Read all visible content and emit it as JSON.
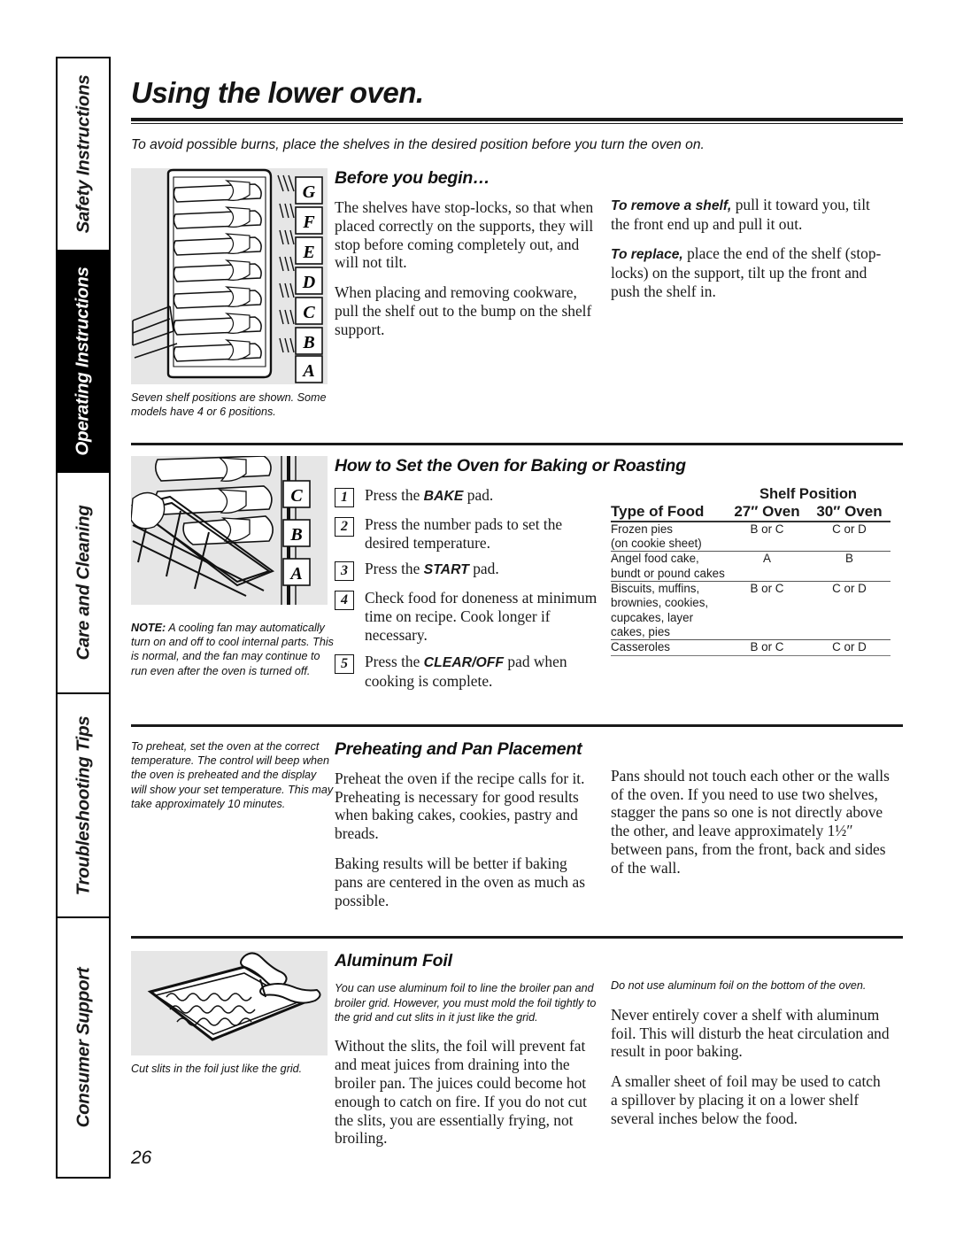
{
  "sidebar": {
    "tabs": [
      {
        "label": "Safety Instructions",
        "active": false
      },
      {
        "label": "Operating Instructions",
        "active": true
      },
      {
        "label": "Care and Cleaning",
        "active": false
      },
      {
        "label": "Troubleshooting Tips",
        "active": false
      },
      {
        "label": "Consumer Support",
        "active": false
      }
    ]
  },
  "header": {
    "title": "Using the lower oven.",
    "lede": "To avoid possible burns, place the shelves in the desired position before you turn the oven on."
  },
  "before_you_begin": {
    "heading": "Before you begin…",
    "left_p1": "The shelves have stop-locks, so that when placed correctly on the supports, they will stop before coming completely out, and will not tilt.",
    "left_p2": "When placing and removing cookware, pull the shelf out to the bump on the shelf support.",
    "right_p1_lead": "To remove a shelf,",
    "right_p1": " pull it toward you, tilt the front end up and pull it out.",
    "right_p2_lead": "To replace,",
    "right_p2": " place the end of the shelf (stop-locks) on the support, tilt up the front and push the shelf in.",
    "art_letters": [
      "G",
      "F",
      "E",
      "D",
      "C",
      "B",
      "A"
    ],
    "caption": "Seven shelf positions are shown. Some models have 4 or 6 positions."
  },
  "baking": {
    "heading": "How to Set the Oven for Baking or Roasting",
    "steps": [
      {
        "num": "1",
        "pre": "Press the ",
        "kbd": "BAKE",
        "post": " pad."
      },
      {
        "num": "2",
        "pre": "Press the number pads to set the desired temperature.",
        "kbd": "",
        "post": ""
      },
      {
        "num": "3",
        "pre": "Press the ",
        "kbd": "START",
        "post": " pad."
      },
      {
        "num": "4",
        "pre": "Check food for doneness at minimum time on recipe. Cook longer if necessary.",
        "kbd": "",
        "post": ""
      },
      {
        "num": "5",
        "pre": "Press the ",
        "kbd": "CLEAR/OFF",
        "post": " pad when cooking is complete."
      }
    ],
    "art_letters": [
      "C",
      "B",
      "A"
    ],
    "note_lead": "NOTE:",
    "note": " A cooling fan may automatically turn on and off to cool internal parts. This is normal, and the fan may continue to run even after the oven is turned off.",
    "table": {
      "spanner": "Shelf Position",
      "columns": [
        "Type of Food",
        "27″ Oven",
        "30″ Oven"
      ],
      "rows": [
        {
          "food": "Frozen pies\n(on cookie sheet)",
          "oven27": "B or C",
          "oven30": "C or D"
        },
        {
          "food": "Angel food cake,\nbundt or pound cakes",
          "oven27": "A",
          "oven30": "B"
        },
        {
          "food": "Biscuits, muffins,\nbrownies, cookies,\ncupcakes, layer\ncakes, pies",
          "oven27": "B or C",
          "oven30": "C or D"
        },
        {
          "food": "Casseroles",
          "oven27": "B or C",
          "oven30": "C or D"
        }
      ]
    }
  },
  "preheating": {
    "heading": "Preheating and Pan Placement",
    "side_note": "To preheat, set the oven at the correct temperature. The control will beep when the oven is preheated and the display will show your set temperature. This may take approximately 10 minutes.",
    "left_p1": "Preheat the oven if the recipe calls for it. Preheating is necessary for good results when baking cakes, cookies, pastry and breads.",
    "left_p2": "Baking results will be better if baking pans are centered in the oven as much as possible.",
    "right_p1": "Pans should not touch each other or the walls of the oven. If you need to use two shelves, stagger the pans so one is not directly above the other, and leave approximately 1½″ between pans, from the front, back and sides of the wall."
  },
  "aluminum_foil": {
    "heading": "Aluminum Foil",
    "left_italic": "You can use aluminum foil to line the broiler pan and broiler grid. However, you must mold the foil tightly to the grid and cut slits in it just like the grid.",
    "left_p1": "Without the slits, the foil will prevent fat and meat juices from draining into the broiler pan. The juices could become hot enough to catch on fire. If you do not cut the slits, you are essentially frying, not broiling.",
    "right_italic": "Do not use aluminum foil on the bottom of the oven.",
    "right_p1": "Never entirely cover a shelf with aluminum foil. This will disturb the heat circulation and result in poor baking.",
    "right_p2": "A smaller sheet of foil may be used to catch a spillover by placing it on a lower shelf several inches below the food.",
    "caption": "Cut slits in the foil just like the grid."
  },
  "footer": {
    "page_number": "26"
  }
}
